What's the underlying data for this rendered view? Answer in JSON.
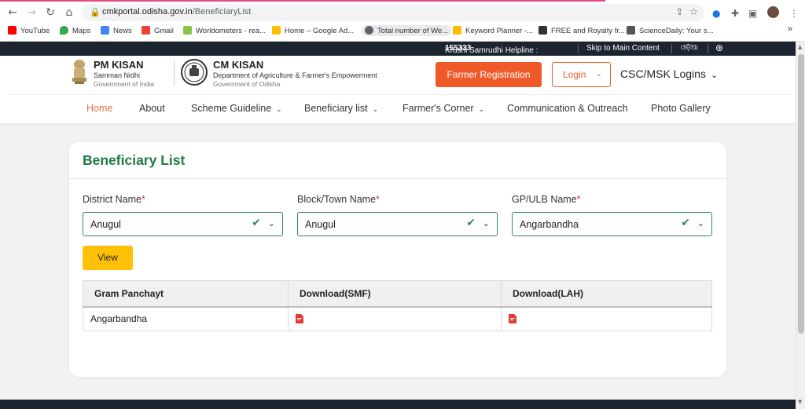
{
  "browser": {
    "url_domain": "cmkportal.odisha.gov.in",
    "url_path": "/BeneficiaryList",
    "bookmarks": [
      {
        "label": "YouTube",
        "color": "#ff0000"
      },
      {
        "label": "Maps",
        "color": "#34a853"
      },
      {
        "label": "News",
        "color": "#4285f4"
      },
      {
        "label": "Gmail",
        "color": "#ea4335"
      },
      {
        "label": "Worldometers - rea...",
        "color": "#8bc34a"
      },
      {
        "label": "Home – Google Ad...",
        "color": "#fbbc04"
      },
      {
        "label": "Total number of We...",
        "color": "#5f6368"
      },
      {
        "label": "Keyword Planner -...",
        "color": "#fbbc04"
      },
      {
        "label": "FREE and Royalty fr...",
        "color": "#333333"
      },
      {
        "label": "ScienceDaily: Your s...",
        "color": "#555555"
      }
    ],
    "more": "»"
  },
  "topbar": {
    "helpline_label": "Krushi Samrudhi Helpline :",
    "helpline_number": "155333",
    "skip_link": "Skip to Main Content",
    "language": "ଓଡ଼ିଆ"
  },
  "header": {
    "pm_title": "PM KISAN",
    "pm_sub": "Samman Nidhi",
    "pm_gov": "Government of India",
    "cm_title": "CM KISAN",
    "cm_sub": "Department of Agriculture & Farmer's Empowerment",
    "cm_gov": "Government of Odisha",
    "register_button": "Farmer Registration",
    "login_button": "Login",
    "csc_menu": "CSC/MSK Logins"
  },
  "menu": {
    "home": "Home",
    "about": "About",
    "scheme": "Scheme Guideline",
    "beneficiary": "Beneficiary list",
    "farmers": "Farmer's Corner",
    "communication": "Communication & Outreach",
    "gallery": "Photo Gallery"
  },
  "card": {
    "title": "Beneficiary List",
    "district_label": "District Name",
    "district_value": "Anugul",
    "block_label": "Block/Town Name",
    "block_value": "Anugul",
    "gp_label": "GP/ULB Name",
    "gp_value": "Angarbandha",
    "required_mark": "*",
    "view_button": "View"
  },
  "table": {
    "headers": [
      "Gram Panchayt",
      "Download(SMF)",
      "Download(LAH)"
    ],
    "rows": [
      {
        "gram_panchayat": "Angarbandha"
      }
    ]
  },
  "colors": {
    "accent_orange": "#f05a28",
    "accent_green": "#1e7a46",
    "view_yellow": "#ffc107",
    "topbar_dark": "#1c2430"
  }
}
